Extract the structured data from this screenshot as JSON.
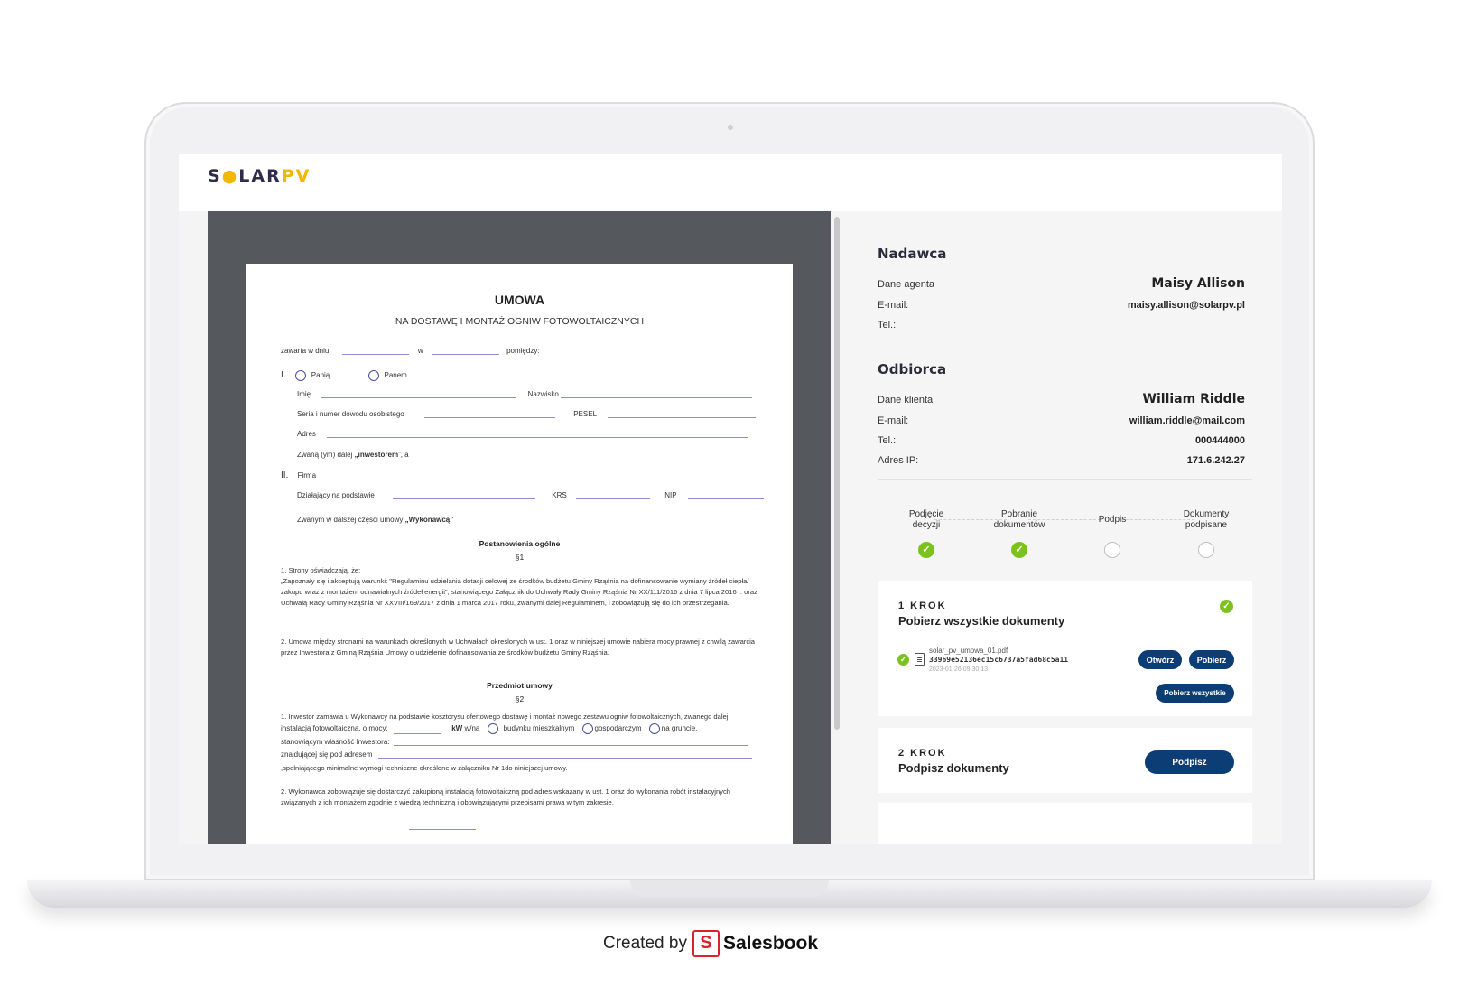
{
  "logo": {
    "s": "S",
    "sun": "●",
    "lar": "LAR",
    "pv": "PV"
  },
  "document": {
    "title": "UMOWA",
    "subtitle": "NA DOSTAWĘ I MONTAŻ OGNIW FOTOWOLTAICZNYCH",
    "zawarta": "zawarta w dniu",
    "w": "w",
    "pomiedzy": "pomiędzy:",
    "roman1": "I.",
    "pani": "Panią",
    "panem": "Panem",
    "imie": "Imię",
    "nazwisko": "Nazwisko",
    "seria": "Seria i numer dowodu osobistego",
    "pesel": "PESEL",
    "adres": "Adres",
    "zwany_pre": "Zwaną (ym) dalej",
    "zwany_bold": "„inwestorem",
    "zwany_post": "”, a",
    "roman2": "II.",
    "firma": "Firma",
    "dzialajacy": "Działający na podstawie",
    "krs": "KRS",
    "nip": "NIP",
    "zwanym_pre": "Zwanym w dalszej części umowy",
    "zwanym_bold": "„Wykonawcą”",
    "postanowienia": "Postanowienia ogólne",
    "par1": "§1",
    "p1": "1. Strony oświadczają, że:",
    "p1b": "„Zapoznały się i akceptują warunki: \"Regulaminu udzielania dotacji celowej ze środków budżetu Gminy Rząśnia na dofinansowanie wymiany źródeł ciepła/ zakupu wraz z montażem odnawialnych źródeł energii\", stanowiącego Załącznik do Uchwały Rady Gminy Rząśnia Nr XX/111/2016 z dnia 7 lipca 2016 r. oraz Uchwałą Rady Gminy Rząśnia Nr XXVIII/169/2017 z dnia 1 marca 2017 roku, zwanymi dalej Regulaminem, i zobowiązują się do ich przestrzegania.",
    "p2": "2. Umowa między stronami na warunkach określonych w Uchwałach określonych w ust. 1 oraz w niniejszej umowie nabiera mocy prawnej z chwilą zawarcia przez Inwestora z Gminą Rząśnia Umowy o udzielenie dofinansowania ze środków budżetu Gminy Rząśnia.",
    "przedmiot": "Przedmiot umowy",
    "par2": "§2",
    "p3": "1. Inwestor zamawia u Wykonawcy na podstawie kosztorysu ofertowego dostawę i montaż nowego zestawu ogniw fotowoltaicznych, zwanego dalej",
    "p3b": "instalacją fotowoltaiczną, o mocy:",
    "kw": "kW",
    "wna": "w/na",
    "budynku": "budynku mieszkalnym",
    "gospodarczym": "gospodarczym",
    "gruncie": "na gruncie,",
    "stanowiacym": "stanowiącym własność Inwestora:",
    "znajdujacej": "znajdującej się pod adresem",
    "spelniajacego": ",spełniającego minimalne wymogi techniczne określone w załączniku Nr 1do niniejszej umowy.",
    "p4": "2. Wykonawca zobowiązuje się dostarczyć zakupioną instalacją fotowoltaiczną pod adres wskazany w ust. 1 oraz do wykonania robót instalacyjnych związanych z ich montażem zgodnie z wiedzą techniczną i obowiązującymi przepisami prawa w tym zakresie."
  },
  "sender": {
    "title": "Nadawca",
    "agent_label": "Dane agenta",
    "agent_value": "Maisy Allison",
    "email_label": "E-mail:",
    "email_value": "maisy.allison@solarpv.pl",
    "tel_label": "Tel.:"
  },
  "recipient": {
    "title": "Odbiorca",
    "client_label": "Dane klienta",
    "client_value": "William Riddle",
    "email_label": "E-mail:",
    "email_value": "william.riddle@mail.com",
    "tel_label": "Tel.:",
    "tel_value": "000444000",
    "ip_label": "Adres IP:",
    "ip_value": "171.6.242.27"
  },
  "steps": [
    {
      "line1": "Podjęcie",
      "line2": "decyzji",
      "done": true
    },
    {
      "line1": "Pobranie",
      "line2": "dokumentów",
      "done": true
    },
    {
      "line1": "Podpis",
      "line2": "",
      "done": false
    },
    {
      "line1": "Dokumenty",
      "line2": "podpisane",
      "done": false
    }
  ],
  "step1": {
    "krok": "1 KROK",
    "title": "Pobierz wszystkie dokumenty",
    "file_name": "solar_pv_umowa_01.pdf",
    "file_hash": "33969e52136ec15c6737a5fad68c5a11",
    "file_date": "2023-01-26 09:30:13",
    "open": "Otwórz",
    "download": "Pobierz",
    "download_all": "Pobierz wszystkie"
  },
  "step2": {
    "krok": "2 KROK",
    "title": "Podpisz dokumenty",
    "sign": "Podpisz"
  },
  "credit": {
    "created_by": "Created by",
    "s": "S",
    "brand": "Salesbook"
  },
  "colors": {
    "accent": "#0d3d75",
    "success": "#7cc21c",
    "logo_yellow": "#f2b705",
    "viewer_bg": "#55585d"
  }
}
